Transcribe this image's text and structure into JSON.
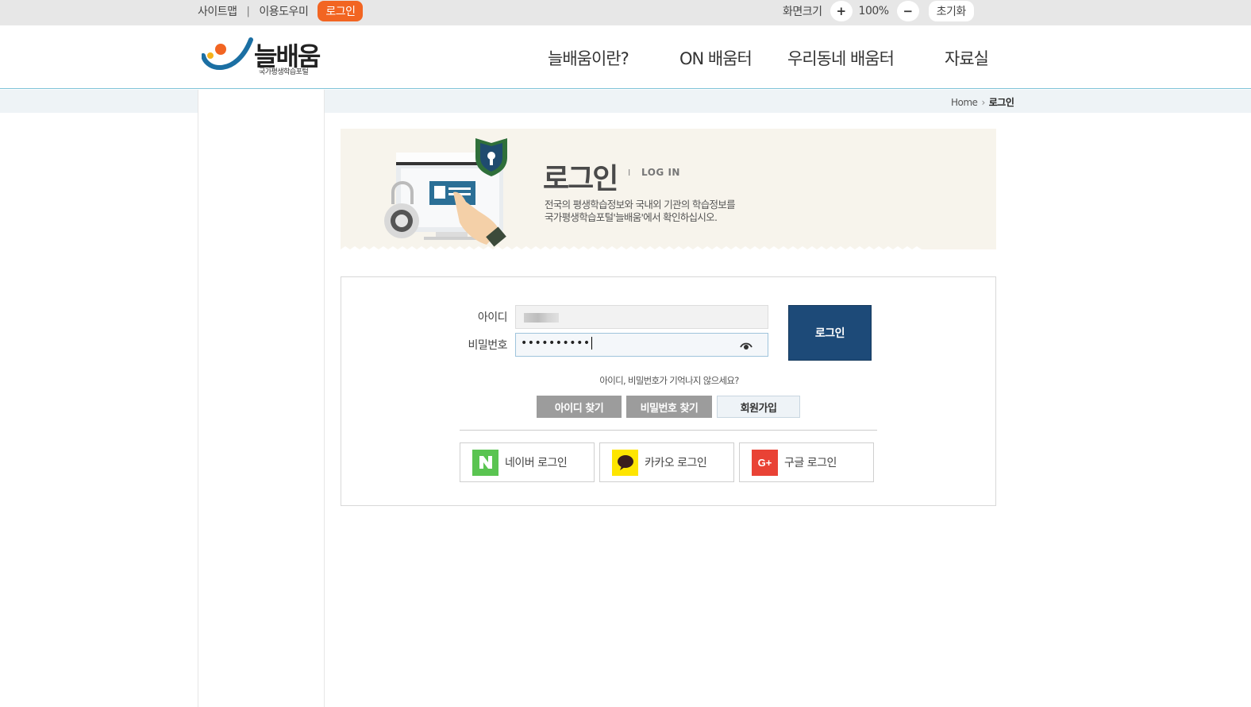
{
  "util": {
    "sitemap": "사이트맵",
    "guide": "이용도우미",
    "login": "로그인",
    "screen_size": "화면크기",
    "zoom_in": "+",
    "zoom_value": "100%",
    "zoom_out": "−",
    "reset": "초기화"
  },
  "header": {
    "logo_word": "늘배움",
    "logo_sub": "국가평생학습포털",
    "nav": [
      "늘배움이란?",
      "ON 배움터",
      "우리동네 배움터",
      "자료실"
    ]
  },
  "breadcrumb": {
    "home": "Home",
    "current": "로그인"
  },
  "banner": {
    "title": "로그인",
    "separator": "I",
    "title_en": "LOG IN",
    "desc_line1": "전국의 평생학습정보와 국내외 기관의 학습정보를",
    "desc_line2": "국가평생학습포털'늘배움'에서 확인하십시오."
  },
  "form": {
    "id_label": "아이디",
    "pw_label": "비밀번호",
    "pw_value": "••••••••••",
    "login_button": "로그인",
    "forgot_text": "아이디, 비밀번호가 기억나지 않으세요?",
    "find_id": "아이디 찾기",
    "find_pw": "비밀번호 찾기",
    "signup": "회원가입"
  },
  "social": {
    "naver": "네이버 로그인",
    "kakao": "카카오 로그인",
    "google": "구글 로그인"
  },
  "colors": {
    "accent_orange": "#f26522",
    "login_blue": "#1d4a78",
    "naver_green": "#5ac451",
    "kakao_yellow": "#fee500",
    "google_red": "#e94235"
  }
}
